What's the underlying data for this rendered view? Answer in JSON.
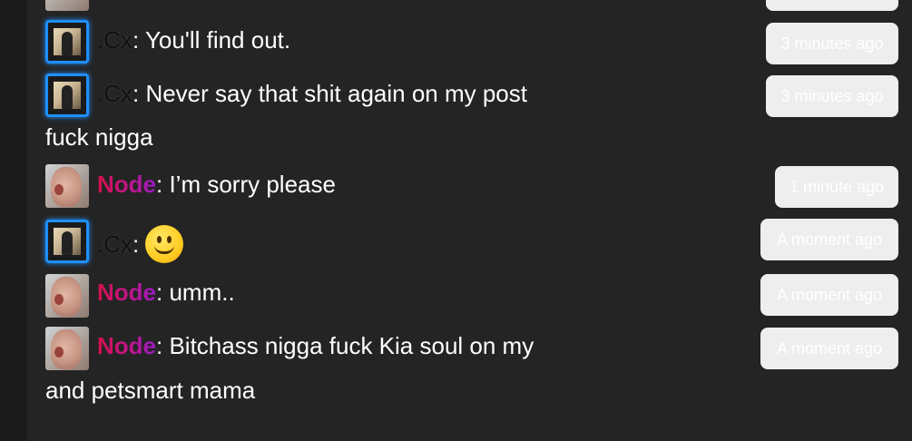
{
  "messages": [
    {
      "user": ".Cx",
      "text": ": You'll find out.",
      "time": "3 minutes ago"
    },
    {
      "user": ".Cx",
      "text": ": Never say that shit again on my post",
      "continuation": "fuck nigga",
      "time": "3 minutes ago"
    },
    {
      "user": "Node",
      "text": ": I’m sorry please",
      "time": "1 minute ago"
    },
    {
      "user": ".Cx",
      "text": ":",
      "emoji": "smiling-face",
      "time": "A moment ago"
    },
    {
      "user": "Node",
      "text": ": umm..",
      "time": "A moment ago"
    },
    {
      "user": "Node",
      "text": ": Bitchass nigga fuck Kia soul on my",
      "continuation": "and petsmart mama",
      "time": "A moment ago"
    }
  ],
  "colors": {
    "background": "#242424",
    "cx_avatar_border": "#1e8fff",
    "node_name_gradient": [
      "#d3114d",
      "#9b1bc6"
    ],
    "timestamp_bg": "#eeeeee"
  }
}
